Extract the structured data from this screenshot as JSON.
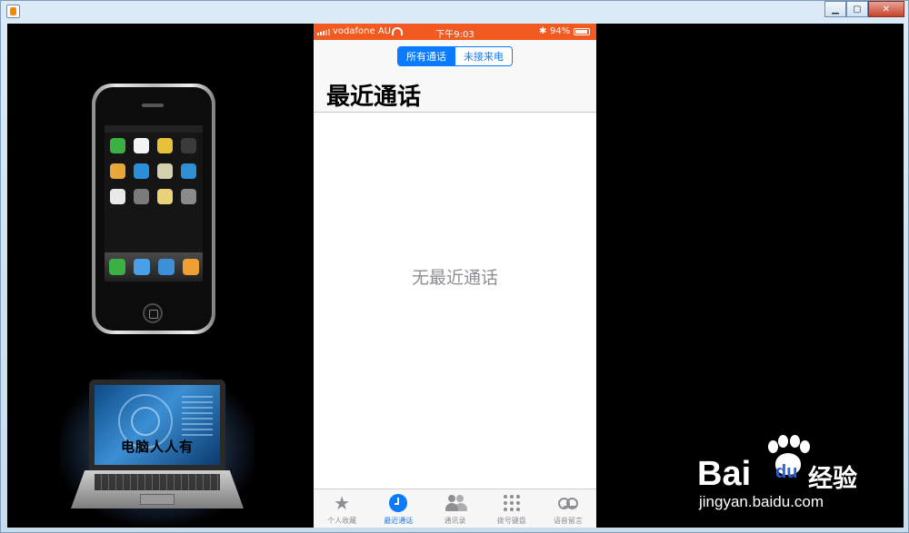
{
  "window": {
    "minimize_icon": "minimize-icon",
    "maximize_icon": "maximize-icon",
    "close_icon": "close-icon"
  },
  "left_panel": {
    "laptop_caption": "电脑人人有"
  },
  "phone": {
    "status": {
      "carrier": "vodafone AU",
      "time": "下午9:03",
      "battery": "94%",
      "bar_color": "#f25a22"
    },
    "segments": {
      "all_calls": "所有通话",
      "missed": "未接来电",
      "selected": "所有通话"
    },
    "title": "最近通话",
    "empty_message": "无最近通话",
    "accent": "#0a7aff",
    "tabs": [
      {
        "label": "个人收藏",
        "icon": "star-icon"
      },
      {
        "label": "最近通话",
        "icon": "clock-icon",
        "active": true
      },
      {
        "label": "通讯录",
        "icon": "contacts-icon"
      },
      {
        "label": "拨号键盘",
        "icon": "keypad-icon"
      },
      {
        "label": "语音留言",
        "icon": "voicemail-icon"
      }
    ]
  },
  "watermark": {
    "brand_bai": "Bai",
    "brand_du": "du",
    "brand_jingyan": "经验",
    "url": "jingyan.baidu.com"
  }
}
